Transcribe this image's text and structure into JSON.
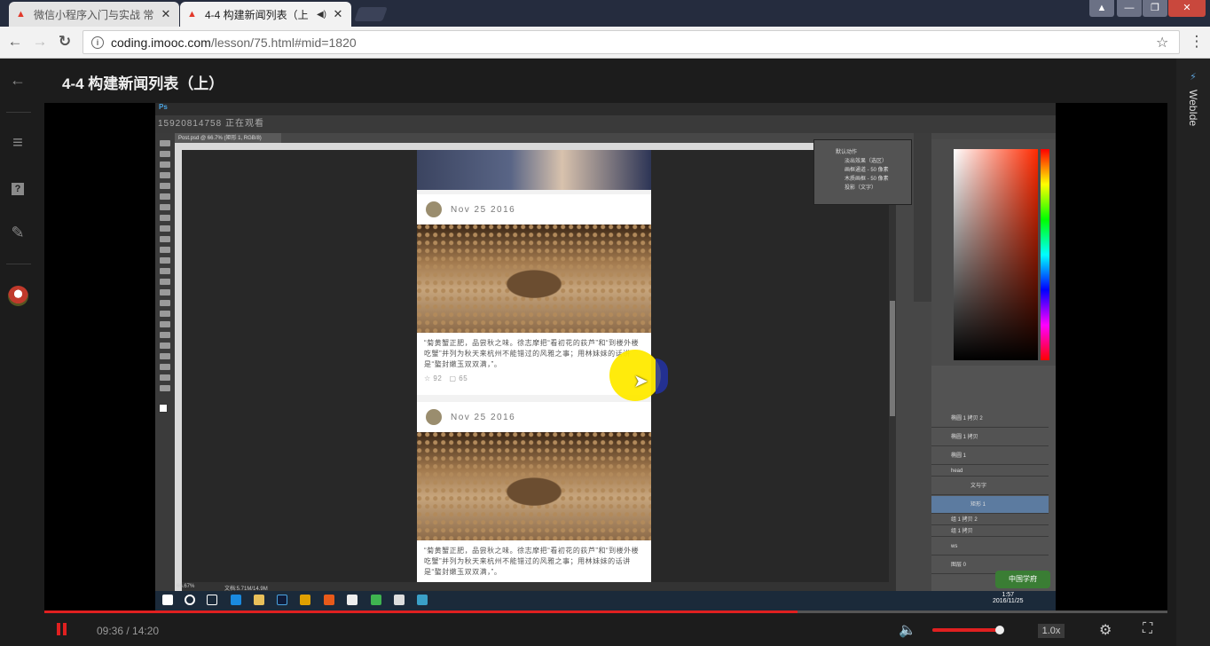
{
  "browser": {
    "tabs": [
      {
        "label": "微信小程序入门与实战 常",
        "close": "✕"
      },
      {
        "label": "4-4 构建新闻列表（上",
        "close": "✕"
      }
    ],
    "window_controls": [
      "▲",
      "—",
      "❐",
      "✕"
    ],
    "nav": {
      "back": "←",
      "forward": "→",
      "reload": "C"
    },
    "url": {
      "host": "coding.imooc.com",
      "path": "/lesson/75.html#mid=1820"
    },
    "star": "☆",
    "menu": "⋮"
  },
  "sidebar": {
    "icons": [
      "arrow-left-icon",
      "list-icon",
      "question-icon",
      "pencil-icon",
      "avatar"
    ],
    "glyphs": {
      "back": "←",
      "menu": "≡",
      "question": "?",
      "edit": "✎"
    }
  },
  "page": {
    "title": "4-4 构建新闻列表（上）"
  },
  "right_panel": {
    "label": "WebIde",
    "icon": "⚡"
  },
  "video": {
    "photoshop": {
      "doc_tab": "Post.psd @ 66.7% (矩形 1, RGB/8)",
      "phone_overlay": "15920814758 正在观看",
      "actions": [
        "默认动作",
        "淡出效果（选区）",
        "画框通道 - 50 像素",
        "木质画框 - 50 像素",
        "投影（文字）"
      ],
      "layers": [
        "椭圆 1 拷贝 2",
        "椭圆 1 拷贝",
        "椭圆 1",
        "head",
        "文与字",
        "矩形 1",
        "组 1 拷贝 2",
        "组 1 拷贝",
        "ws",
        "图层 0"
      ],
      "zoom": "66.67%",
      "doc_size": "文档:5.71M/14.9M"
    },
    "feed": {
      "date": "Nov 25 2016",
      "text": "“菊黄蟹正肥，品尝秋之味。徐志摩把“看初花的荻芦”和“到楼外楼吃蟹”并列为秋天来杭州不能错过的风雅之事；用林妹妹的话讲是“螯封嫩玉双双满，”。",
      "likes": "☆ 92",
      "comments": "▢ 65"
    },
    "watermark": "中国学府",
    "taskbar_time": "1:57",
    "taskbar_date": "2016/11/25"
  },
  "controls": {
    "time": "09:36 / 14:20",
    "progress": 0.671,
    "volume": 0.95,
    "speed": "1.0x",
    "volume_icon": "🔈",
    "settings_icon": "⚙",
    "fullscreen_icon": "⛶"
  }
}
